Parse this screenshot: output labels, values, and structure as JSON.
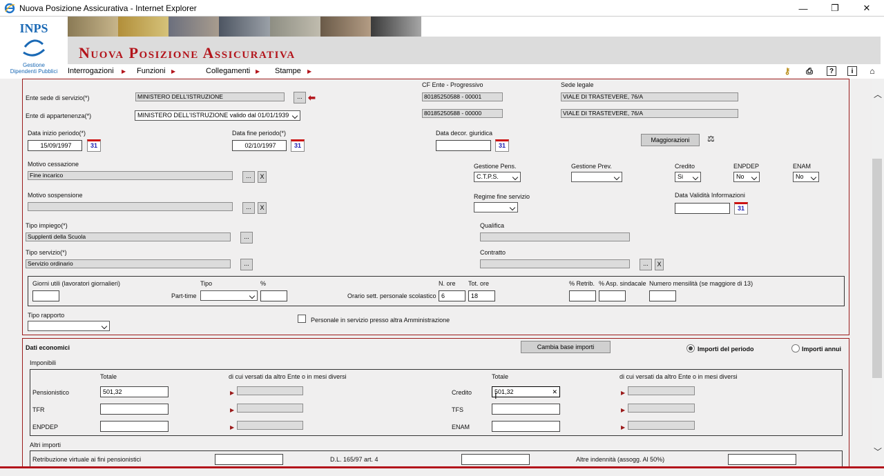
{
  "window": {
    "title": "Nuova Posizione Assicurativa - Internet Explorer",
    "controls": {
      "minimize": "—",
      "restore": "❐",
      "close": "✕"
    }
  },
  "header": {
    "logo_text": "INPS",
    "logo_subtitle_1": "Gestione",
    "logo_subtitle_2": "Dipendenti Pubblici",
    "banner_title": "Nuova Posizione Assicurativa",
    "menu": [
      "Interrogazioni",
      "Funzioni",
      "Collegamenti",
      "Stampe"
    ],
    "tools": [
      "key-icon",
      "print-icon",
      "help-icon",
      "info-icon",
      "home-icon"
    ]
  },
  "service": {
    "ente_sede_label": "Ente sede di servizio(*)",
    "ente_sede_value": "MINISTERO DELL'ISTRUZIONE",
    "ente_appartenenza_label": "Ente di appartenenza(*)",
    "ente_appartenenza_value": "MINISTERO DELL'ISTRUZIONE valido dal 01/01/1939",
    "cf_label": "CF Ente - Progressivo",
    "cf_1": "80185250588 - 00001",
    "cf_2": "80185250588 - 00000",
    "sede_legale_label": "Sede legale",
    "sede_legale_1": "VIALE DI TRASTEVERE, 76/A",
    "sede_legale_2": "VIALE DI TRASTEVERE, 76/A",
    "ellipsis": "...",
    "x": "X"
  },
  "period": {
    "inizio_label": "Data inizio periodo(*)",
    "inizio_value": "15/09/1997",
    "fine_label": "Data fine periodo(*)",
    "fine_value": "02/10/1997",
    "decor_label": "Data decor. giuridica",
    "decor_value": "",
    "cal_text": "31",
    "maggiorazioni": "Maggiorazioni"
  },
  "motivi": {
    "cessazione_label": "Motivo cessazione",
    "cessazione_value": "Fine incarico",
    "sospensione_label": "Motivo sospensione",
    "sospensione_value": ""
  },
  "gestione": {
    "pens_label": "Gestione Pens.",
    "pens_value": "C.T.P.S.",
    "prev_label": "Gestione Prev.",
    "prev_value": "",
    "credito_label": "Credito",
    "credito_value": "Si",
    "enpdep_label": "ENPDEP",
    "enpdep_value": "No",
    "enam_label": "ENAM",
    "enam_value": "No",
    "regime_label": "Regime fine servizio",
    "regime_value": "",
    "validita_label": "Data Validità Informazioni",
    "validita_value": ""
  },
  "impiego": {
    "tipo_impiego_label": "Tipo impiego(*)",
    "tipo_impiego_value": "Supplenti della Scuola",
    "qualifica_label": "Qualifica",
    "qualifica_value": "",
    "tipo_servizio_label": "Tipo servizio(*)",
    "tipo_servizio_value": "Servizio ordinario",
    "contratto_label": "Contratto",
    "contratto_value": ""
  },
  "orario": {
    "giorni_label": "Giorni utili (lavoratori giornalieri)",
    "tipo_label": "Tipo",
    "perc_label": "%",
    "parttime_label": "Part-time",
    "nore_label": "N. ore",
    "totore_label": "Tot. ore",
    "orario_label": "Orario sett. personale scolastico",
    "nore_value": "6",
    "totore_value": "18",
    "retrib_label": "% Retrib.",
    "asp_label": "% Asp. sindacale",
    "mensilita_label": "Numero mensilità (se maggiore di 13)"
  },
  "rapporto": {
    "tipo_label": "Tipo rapporto",
    "personale_label": "Personale in servizio presso altra Amministrazione"
  },
  "economici": {
    "title": "Dati economici",
    "cambia_button": "Cambia base importi",
    "radio_periodo": "Importi del periodo",
    "radio_annui": "Importi annui",
    "imponibili_label": "Imponibili",
    "totale_label": "Totale",
    "versati_label": "di cui versati da altro Ente o in mesi diversi",
    "pensionistico_label": "Pensionistico",
    "pensionistico_value": "501,32",
    "tfr_label": "TFR",
    "enpdep_label": "ENPDEP",
    "credito_label": "Credito",
    "credito_value": "501,32",
    "clear_glyph": "✕",
    "tfs_label": "TFS",
    "enam_label": "ENAM",
    "altri_label": "Altri importi",
    "retribuzione_label": "Retribuzione virtuale ai fini pensionistici",
    "dl_label": "D.L. 165/97 art. 4",
    "altre_label": "Altre indennità (assogg. Al 50%)"
  }
}
